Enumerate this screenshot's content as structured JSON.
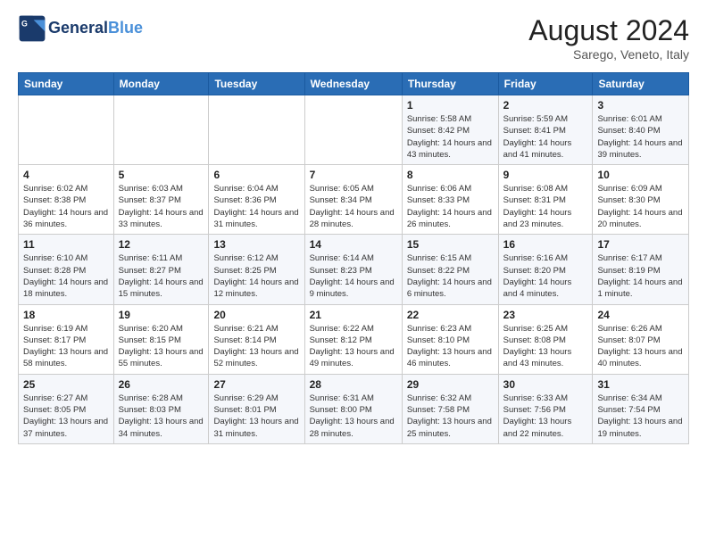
{
  "logo": {
    "line1": "General",
    "line2": "Blue"
  },
  "title": {
    "month_year": "August 2024",
    "location": "Sarego, Veneto, Italy"
  },
  "weekdays": [
    "Sunday",
    "Monday",
    "Tuesday",
    "Wednesday",
    "Thursday",
    "Friday",
    "Saturday"
  ],
  "weeks": [
    [
      {
        "day": "",
        "info": ""
      },
      {
        "day": "",
        "info": ""
      },
      {
        "day": "",
        "info": ""
      },
      {
        "day": "",
        "info": ""
      },
      {
        "day": "1",
        "info": "Sunrise: 5:58 AM\nSunset: 8:42 PM\nDaylight: 14 hours\nand 43 minutes."
      },
      {
        "day": "2",
        "info": "Sunrise: 5:59 AM\nSunset: 8:41 PM\nDaylight: 14 hours\nand 41 minutes."
      },
      {
        "day": "3",
        "info": "Sunrise: 6:01 AM\nSunset: 8:40 PM\nDaylight: 14 hours\nand 39 minutes."
      }
    ],
    [
      {
        "day": "4",
        "info": "Sunrise: 6:02 AM\nSunset: 8:38 PM\nDaylight: 14 hours\nand 36 minutes."
      },
      {
        "day": "5",
        "info": "Sunrise: 6:03 AM\nSunset: 8:37 PM\nDaylight: 14 hours\nand 33 minutes."
      },
      {
        "day": "6",
        "info": "Sunrise: 6:04 AM\nSunset: 8:36 PM\nDaylight: 14 hours\nand 31 minutes."
      },
      {
        "day": "7",
        "info": "Sunrise: 6:05 AM\nSunset: 8:34 PM\nDaylight: 14 hours\nand 28 minutes."
      },
      {
        "day": "8",
        "info": "Sunrise: 6:06 AM\nSunset: 8:33 PM\nDaylight: 14 hours\nand 26 minutes."
      },
      {
        "day": "9",
        "info": "Sunrise: 6:08 AM\nSunset: 8:31 PM\nDaylight: 14 hours\nand 23 minutes."
      },
      {
        "day": "10",
        "info": "Sunrise: 6:09 AM\nSunset: 8:30 PM\nDaylight: 14 hours\nand 20 minutes."
      }
    ],
    [
      {
        "day": "11",
        "info": "Sunrise: 6:10 AM\nSunset: 8:28 PM\nDaylight: 14 hours\nand 18 minutes."
      },
      {
        "day": "12",
        "info": "Sunrise: 6:11 AM\nSunset: 8:27 PM\nDaylight: 14 hours\nand 15 minutes."
      },
      {
        "day": "13",
        "info": "Sunrise: 6:12 AM\nSunset: 8:25 PM\nDaylight: 14 hours\nand 12 minutes."
      },
      {
        "day": "14",
        "info": "Sunrise: 6:14 AM\nSunset: 8:23 PM\nDaylight: 14 hours\nand 9 minutes."
      },
      {
        "day": "15",
        "info": "Sunrise: 6:15 AM\nSunset: 8:22 PM\nDaylight: 14 hours\nand 6 minutes."
      },
      {
        "day": "16",
        "info": "Sunrise: 6:16 AM\nSunset: 8:20 PM\nDaylight: 14 hours\nand 4 minutes."
      },
      {
        "day": "17",
        "info": "Sunrise: 6:17 AM\nSunset: 8:19 PM\nDaylight: 14 hours\nand 1 minute."
      }
    ],
    [
      {
        "day": "18",
        "info": "Sunrise: 6:19 AM\nSunset: 8:17 PM\nDaylight: 13 hours\nand 58 minutes."
      },
      {
        "day": "19",
        "info": "Sunrise: 6:20 AM\nSunset: 8:15 PM\nDaylight: 13 hours\nand 55 minutes."
      },
      {
        "day": "20",
        "info": "Sunrise: 6:21 AM\nSunset: 8:14 PM\nDaylight: 13 hours\nand 52 minutes."
      },
      {
        "day": "21",
        "info": "Sunrise: 6:22 AM\nSunset: 8:12 PM\nDaylight: 13 hours\nand 49 minutes."
      },
      {
        "day": "22",
        "info": "Sunrise: 6:23 AM\nSunset: 8:10 PM\nDaylight: 13 hours\nand 46 minutes."
      },
      {
        "day": "23",
        "info": "Sunrise: 6:25 AM\nSunset: 8:08 PM\nDaylight: 13 hours\nand 43 minutes."
      },
      {
        "day": "24",
        "info": "Sunrise: 6:26 AM\nSunset: 8:07 PM\nDaylight: 13 hours\nand 40 minutes."
      }
    ],
    [
      {
        "day": "25",
        "info": "Sunrise: 6:27 AM\nSunset: 8:05 PM\nDaylight: 13 hours\nand 37 minutes."
      },
      {
        "day": "26",
        "info": "Sunrise: 6:28 AM\nSunset: 8:03 PM\nDaylight: 13 hours\nand 34 minutes."
      },
      {
        "day": "27",
        "info": "Sunrise: 6:29 AM\nSunset: 8:01 PM\nDaylight: 13 hours\nand 31 minutes."
      },
      {
        "day": "28",
        "info": "Sunrise: 6:31 AM\nSunset: 8:00 PM\nDaylight: 13 hours\nand 28 minutes."
      },
      {
        "day": "29",
        "info": "Sunrise: 6:32 AM\nSunset: 7:58 PM\nDaylight: 13 hours\nand 25 minutes."
      },
      {
        "day": "30",
        "info": "Sunrise: 6:33 AM\nSunset: 7:56 PM\nDaylight: 13 hours\nand 22 minutes."
      },
      {
        "day": "31",
        "info": "Sunrise: 6:34 AM\nSunset: 7:54 PM\nDaylight: 13 hours\nand 19 minutes."
      }
    ]
  ]
}
